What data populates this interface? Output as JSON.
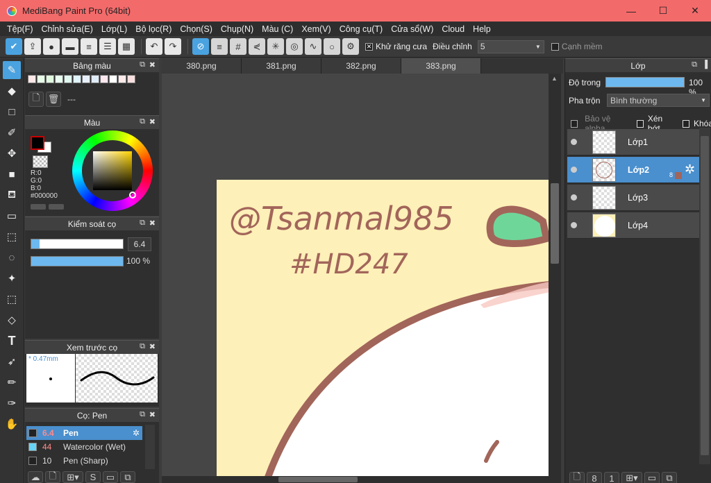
{
  "window": {
    "title": "MediBang Paint Pro (64bit)",
    "min": "—",
    "max": "☐",
    "close": "✕"
  },
  "menu": [
    "Tệp(F)",
    "Chỉnh sửa(E)",
    "Lớp(L)",
    "Bộ lọc(R)",
    "Chọn(S)",
    "Chụp(N)",
    "Màu (C)",
    "Xem(V)",
    "Công cụ(T)",
    "Cửa sổ(W)",
    "Cloud",
    "Help"
  ],
  "toolbar": {
    "antialias_label": "Khử răng cưa",
    "adjust_label": "Điều chỉnh",
    "adjust_value": "5",
    "soft_edge_label": "Cạnh mềm"
  },
  "palette_panel": {
    "title": "Bảng màu",
    "file_label": "---"
  },
  "color_panel": {
    "title": "Màu",
    "r": "R:0",
    "g": "G:0",
    "b": "B:0",
    "hex": "#000000",
    "foreground": "#000000",
    "background": "#ffffff"
  },
  "brush_control": {
    "title": "Kiểm soát cọ",
    "size_value": "6.4",
    "opacity_value": "100 %",
    "size_fraction": 0.09,
    "opacity_fraction": 1.0
  },
  "brush_preview": {
    "title": "Xem trước cọ",
    "size_mm": "* 0.47mm"
  },
  "brush_list": {
    "title": "Cọ: Pen",
    "items": [
      {
        "size": "6.4",
        "name": "Pen",
        "color": "#222222"
      },
      {
        "size": "44",
        "name": "Watercolor (Wet)",
        "color": "#67d4f5"
      },
      {
        "size": "10",
        "name": "Pen (Sharp)",
        "color": "#222222"
      }
    ]
  },
  "tabs": [
    "380.png",
    "381.png",
    "382.png",
    "383.png"
  ],
  "canvas": {
    "signature_line1": "@Tsanmal985",
    "signature_line2": "#HD247",
    "paper_color": "#fdf0b8",
    "outline_color": "#a2655a",
    "leaf_color": "#6fd69a"
  },
  "layers_panel": {
    "title": "Lớp",
    "opacity_label": "Độ trong",
    "opacity_value": "100 %",
    "blend_label": "Pha trộn",
    "blend_value": "Bình thường",
    "protect_alpha": "Bảo vệ alpha",
    "clipping": "Xén bớt",
    "lock": "Khóa",
    "layers": [
      {
        "name": "Lớp1"
      },
      {
        "name": "Lớp2",
        "badge": "8"
      },
      {
        "name": "Lớp3"
      },
      {
        "name": "Lớp4"
      }
    ]
  }
}
